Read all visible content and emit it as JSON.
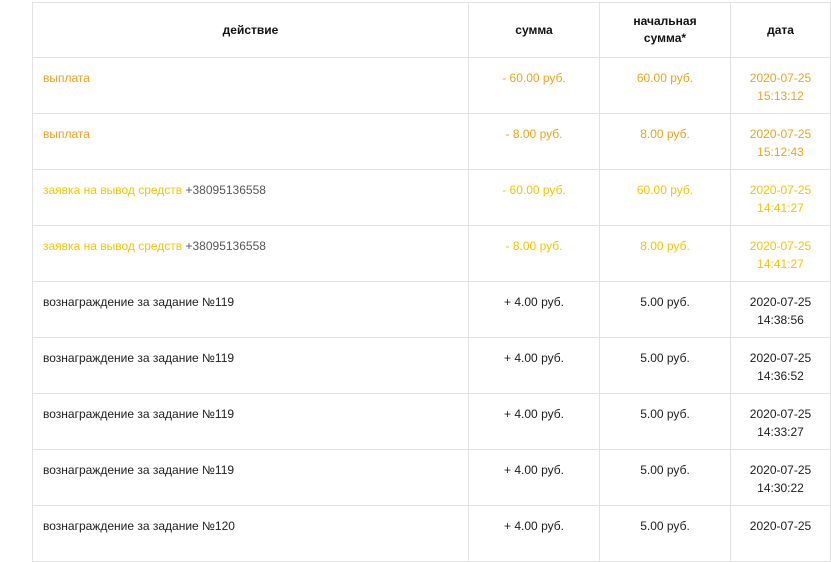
{
  "table": {
    "headers": {
      "action": "действие",
      "sum": "сумма",
      "start_line1": "начальная",
      "start_line2": "сумма*",
      "date": "дата"
    },
    "rows": [
      {
        "action": "выплата",
        "phone": "",
        "sum": "- 60.00 руб.",
        "start": "60.00 руб.",
        "date": "2020-07-25",
        "time": "15:13:12",
        "color": "#f0a21a"
      },
      {
        "action": "выплата",
        "phone": "",
        "sum": "- 8.00 руб.",
        "start": "8.00 руб.",
        "date": "2020-07-25",
        "time": "15:12:43",
        "color": "#f0a21a"
      },
      {
        "action": "заявка на вывод средств",
        "phone": "+38095136558",
        "sum": "- 60.00 руб.",
        "start": "60.00 руб.",
        "date": "2020-07-25",
        "time": "14:41:27",
        "color": "#f5c400"
      },
      {
        "action": "заявка на вывод средств",
        "phone": "+38095136558",
        "sum": "- 8.00 руб.",
        "start": "8.00 руб.",
        "date": "2020-07-25",
        "time": "14:41:27",
        "color": "#f5c400"
      },
      {
        "action": "вознаграждение за задание №119",
        "phone": "",
        "sum": "+ 4.00 руб.",
        "start": "5.00 руб.",
        "date": "2020-07-25",
        "time": "14:38:56",
        "color": "#1c1c1c"
      },
      {
        "action": "вознаграждение за задание №119",
        "phone": "",
        "sum": "+ 4.00 руб.",
        "start": "5.00 руб.",
        "date": "2020-07-25",
        "time": "14:36:52",
        "color": "#1c1c1c"
      },
      {
        "action": "вознаграждение за задание №119",
        "phone": "",
        "sum": "+ 4.00 руб.",
        "start": "5.00 руб.",
        "date": "2020-07-25",
        "time": "14:33:27",
        "color": "#1c1c1c"
      },
      {
        "action": "вознаграждение за задание №119",
        "phone": "",
        "sum": "+ 4.00 руб.",
        "start": "5.00 руб.",
        "date": "2020-07-25",
        "time": "14:30:22",
        "color": "#1c1c1c"
      },
      {
        "action": "вознаграждение за задание №120",
        "phone": "",
        "sum": "+ 4.00 руб.",
        "start": "5.00 руб.",
        "date": "2020-07-25",
        "time": "",
        "color": "#1c1c1c"
      }
    ]
  }
}
